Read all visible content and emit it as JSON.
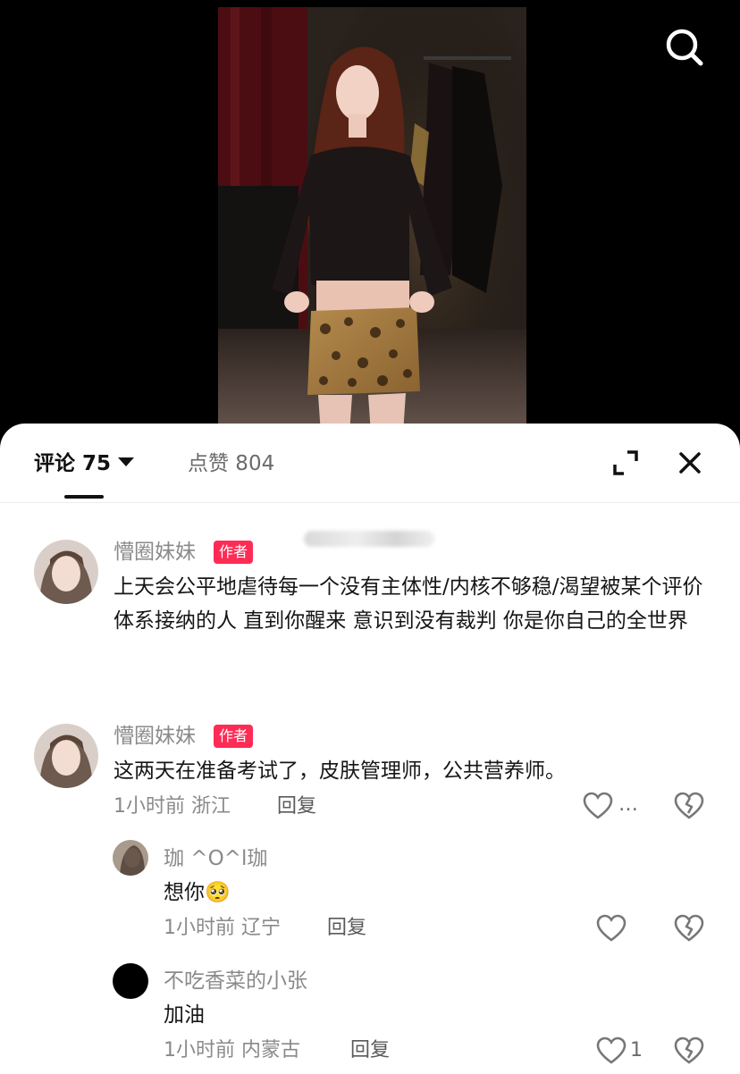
{
  "tabs": {
    "comments": "评论 75",
    "likes": "点赞 804"
  },
  "icons": {
    "search": "search-icon",
    "expand": "expand-icon",
    "close": "close-icon",
    "like": "heart-outline-icon",
    "dislike": "broken-heart-icon",
    "more": "more-dots-icon"
  },
  "colors": {
    "accent": "#fe2c55",
    "muted_text": "#8a8a8a"
  },
  "comments": [
    {
      "user": "懵圈妹妹",
      "badge": "作者",
      "text": "上天会公平地虐待每一个没有主体性/内核不够稳/渴望被某个评价体系接纳的人 直到你醒来 意识到没有裁判 你是你自己的全世界"
    },
    {
      "user": "懵圈妹妹",
      "badge": "作者",
      "text": "这两天在准备考试了，皮肤管理师，公共营养师。",
      "meta": "1小时前 浙江",
      "reply_label": "回复",
      "more": "…"
    }
  ],
  "replies": [
    {
      "user": "珈 ^O^l珈",
      "text": "想你",
      "emoji": "🥺",
      "meta": "1小时前 辽宁",
      "reply_label": "回复"
    },
    {
      "user": "不吃香菜的小张",
      "text": "加油",
      "meta": "1小时前 内蒙古",
      "reply_label": "回复",
      "likes": "1"
    }
  ]
}
